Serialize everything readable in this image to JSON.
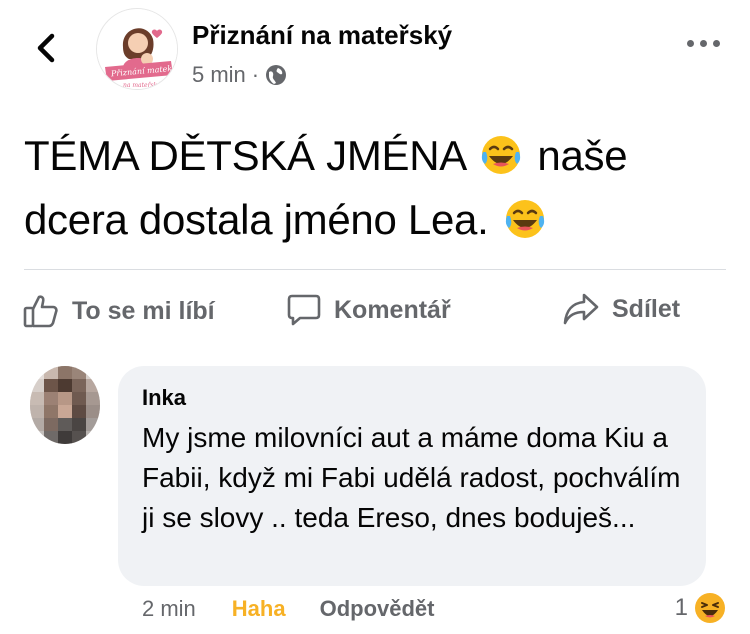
{
  "header": {
    "page_name": "Přiznání na mateřský",
    "time": "5 min",
    "separator": "·",
    "privacy_icon": "globe-icon",
    "more_icon": "more-horizontal-icon",
    "back_icon": "chevron-left-icon",
    "logo_text_line1": "Přiznání matek",
    "logo_text_line2": "na mateřský"
  },
  "post": {
    "line1": "TÉMA DĚTSKÁ JMÉNA",
    "line1_tail": "naše",
    "line2": "dcera dostala jméno Lea.",
    "emoji": "laughing-tears-emoji"
  },
  "actions": {
    "like": "To se mi líbí",
    "comment": "Komentář",
    "share": "Sdílet"
  },
  "comment": {
    "author": "Inka",
    "text": "My jsme milovníci aut a máme doma Kiu a Fabii, když mi Fabi udělá radost, pochválím ji se slovy .. teda Ereso, dnes boduješ...",
    "time": "2 min",
    "reaction": "Haha",
    "reply": "Odpovědět",
    "reaction_count": "1",
    "reaction_icon": "haha-emoji"
  },
  "colors": {
    "text": "#050505",
    "muted": "#65676b",
    "bubble": "#f0f2f5",
    "haha": "#f7b125",
    "brand_pink": "#d9537a"
  }
}
